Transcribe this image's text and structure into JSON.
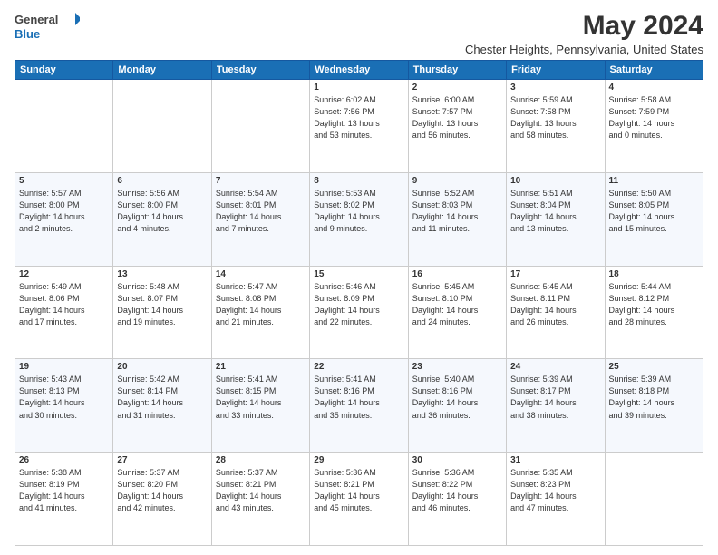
{
  "header": {
    "logo_line1": "General",
    "logo_line2": "Blue",
    "title": "May 2024",
    "subtitle": "Chester Heights, Pennsylvania, United States"
  },
  "calendar": {
    "days_of_week": [
      "Sunday",
      "Monday",
      "Tuesday",
      "Wednesday",
      "Thursday",
      "Friday",
      "Saturday"
    ],
    "weeks": [
      [
        {
          "day": "",
          "info": ""
        },
        {
          "day": "",
          "info": ""
        },
        {
          "day": "",
          "info": ""
        },
        {
          "day": "1",
          "info": "Sunrise: 6:02 AM\nSunset: 7:56 PM\nDaylight: 13 hours\nand 53 minutes."
        },
        {
          "day": "2",
          "info": "Sunrise: 6:00 AM\nSunset: 7:57 PM\nDaylight: 13 hours\nand 56 minutes."
        },
        {
          "day": "3",
          "info": "Sunrise: 5:59 AM\nSunset: 7:58 PM\nDaylight: 13 hours\nand 58 minutes."
        },
        {
          "day": "4",
          "info": "Sunrise: 5:58 AM\nSunset: 7:59 PM\nDaylight: 14 hours\nand 0 minutes."
        }
      ],
      [
        {
          "day": "5",
          "info": "Sunrise: 5:57 AM\nSunset: 8:00 PM\nDaylight: 14 hours\nand 2 minutes."
        },
        {
          "day": "6",
          "info": "Sunrise: 5:56 AM\nSunset: 8:00 PM\nDaylight: 14 hours\nand 4 minutes."
        },
        {
          "day": "7",
          "info": "Sunrise: 5:54 AM\nSunset: 8:01 PM\nDaylight: 14 hours\nand 7 minutes."
        },
        {
          "day": "8",
          "info": "Sunrise: 5:53 AM\nSunset: 8:02 PM\nDaylight: 14 hours\nand 9 minutes."
        },
        {
          "day": "9",
          "info": "Sunrise: 5:52 AM\nSunset: 8:03 PM\nDaylight: 14 hours\nand 11 minutes."
        },
        {
          "day": "10",
          "info": "Sunrise: 5:51 AM\nSunset: 8:04 PM\nDaylight: 14 hours\nand 13 minutes."
        },
        {
          "day": "11",
          "info": "Sunrise: 5:50 AM\nSunset: 8:05 PM\nDaylight: 14 hours\nand 15 minutes."
        }
      ],
      [
        {
          "day": "12",
          "info": "Sunrise: 5:49 AM\nSunset: 8:06 PM\nDaylight: 14 hours\nand 17 minutes."
        },
        {
          "day": "13",
          "info": "Sunrise: 5:48 AM\nSunset: 8:07 PM\nDaylight: 14 hours\nand 19 minutes."
        },
        {
          "day": "14",
          "info": "Sunrise: 5:47 AM\nSunset: 8:08 PM\nDaylight: 14 hours\nand 21 minutes."
        },
        {
          "day": "15",
          "info": "Sunrise: 5:46 AM\nSunset: 8:09 PM\nDaylight: 14 hours\nand 22 minutes."
        },
        {
          "day": "16",
          "info": "Sunrise: 5:45 AM\nSunset: 8:10 PM\nDaylight: 14 hours\nand 24 minutes."
        },
        {
          "day": "17",
          "info": "Sunrise: 5:45 AM\nSunset: 8:11 PM\nDaylight: 14 hours\nand 26 minutes."
        },
        {
          "day": "18",
          "info": "Sunrise: 5:44 AM\nSunset: 8:12 PM\nDaylight: 14 hours\nand 28 minutes."
        }
      ],
      [
        {
          "day": "19",
          "info": "Sunrise: 5:43 AM\nSunset: 8:13 PM\nDaylight: 14 hours\nand 30 minutes."
        },
        {
          "day": "20",
          "info": "Sunrise: 5:42 AM\nSunset: 8:14 PM\nDaylight: 14 hours\nand 31 minutes."
        },
        {
          "day": "21",
          "info": "Sunrise: 5:41 AM\nSunset: 8:15 PM\nDaylight: 14 hours\nand 33 minutes."
        },
        {
          "day": "22",
          "info": "Sunrise: 5:41 AM\nSunset: 8:16 PM\nDaylight: 14 hours\nand 35 minutes."
        },
        {
          "day": "23",
          "info": "Sunrise: 5:40 AM\nSunset: 8:16 PM\nDaylight: 14 hours\nand 36 minutes."
        },
        {
          "day": "24",
          "info": "Sunrise: 5:39 AM\nSunset: 8:17 PM\nDaylight: 14 hours\nand 38 minutes."
        },
        {
          "day": "25",
          "info": "Sunrise: 5:39 AM\nSunset: 8:18 PM\nDaylight: 14 hours\nand 39 minutes."
        }
      ],
      [
        {
          "day": "26",
          "info": "Sunrise: 5:38 AM\nSunset: 8:19 PM\nDaylight: 14 hours\nand 41 minutes."
        },
        {
          "day": "27",
          "info": "Sunrise: 5:37 AM\nSunset: 8:20 PM\nDaylight: 14 hours\nand 42 minutes."
        },
        {
          "day": "28",
          "info": "Sunrise: 5:37 AM\nSunset: 8:21 PM\nDaylight: 14 hours\nand 43 minutes."
        },
        {
          "day": "29",
          "info": "Sunrise: 5:36 AM\nSunset: 8:21 PM\nDaylight: 14 hours\nand 45 minutes."
        },
        {
          "day": "30",
          "info": "Sunrise: 5:36 AM\nSunset: 8:22 PM\nDaylight: 14 hours\nand 46 minutes."
        },
        {
          "day": "31",
          "info": "Sunrise: 5:35 AM\nSunset: 8:23 PM\nDaylight: 14 hours\nand 47 minutes."
        },
        {
          "day": "",
          "info": ""
        }
      ]
    ]
  }
}
